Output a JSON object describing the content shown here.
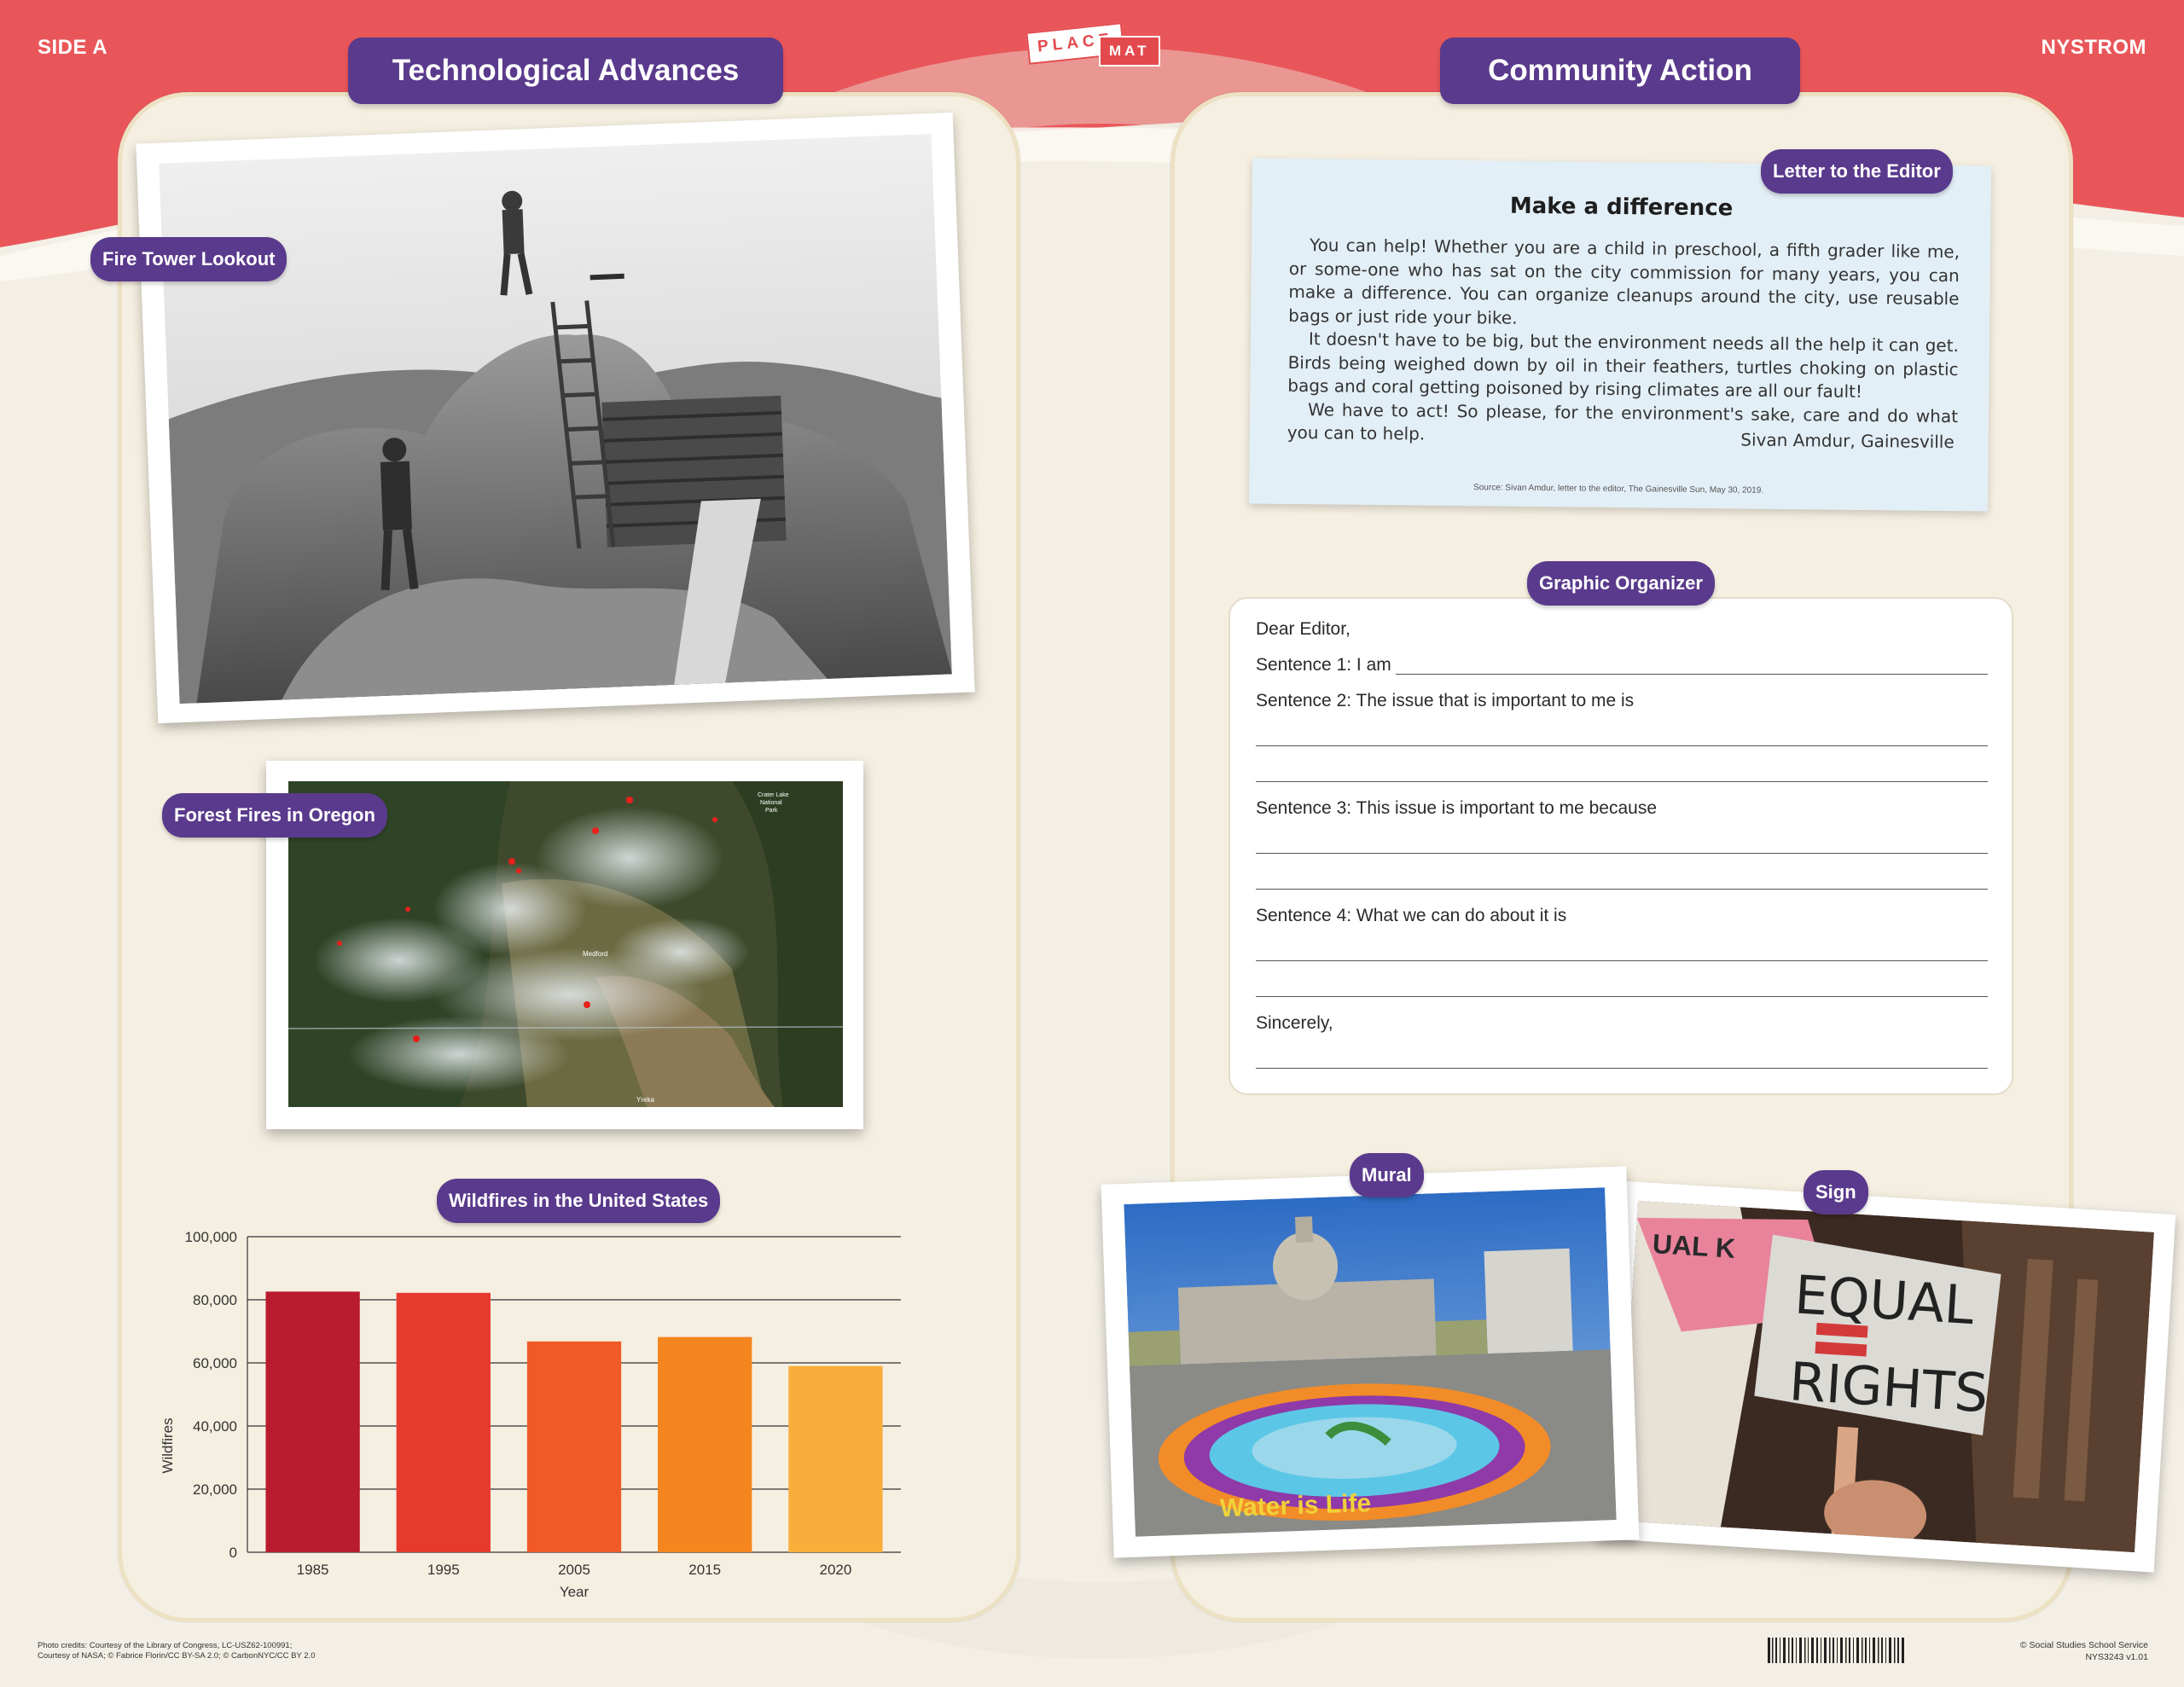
{
  "header": {
    "side_label": "SIDE A",
    "brand": "NYSTROM",
    "logo_top": "PLACE",
    "logo_bottom": "MAT"
  },
  "left_panel": {
    "title": "Technological Advances",
    "fire_tower_label": "Fire Tower Lookout",
    "forest_fires_label": "Forest Fires in Oregon",
    "map_labels": {
      "park": "Crater Lake National Park",
      "city": "Medford",
      "bottom": "Yreka"
    },
    "chart_label": "Wildfires in the United States"
  },
  "right_panel": {
    "title": "Community Action",
    "letter_label": "Letter to the Editor",
    "letter": {
      "title": "Make a difference",
      "paragraphs": [
        "You can help! Whether you are a child in preschool, a fifth grader like me, or some-one who has sat on the city commission for many years, you can make a difference. You can organize cleanups around the city, use reusable bags or just ride your bike.",
        "It doesn't have to be big, but the environment needs all the help it can get. Birds being weighed down by oil in their feathers, turtles choking on plastic bags and coral getting poisoned by rising climates are all our fault!",
        "We have to act! So please, for the environment's sake, care and do what you can to help."
      ],
      "signature": "Sivan Amdur, Gainesville",
      "source": "Source: Sivan Amdur, letter to the editor, The Gainesville Sun, May 30, 2019."
    },
    "organizer_label": "Graphic Organizer",
    "organizer": {
      "greeting": "Dear Editor,",
      "s1": "Sentence 1: I am",
      "s2": "Sentence 2: The issue that is important to me is",
      "s3": "Sentence 3: This issue is important to me because",
      "s4": "Sentence 4: What we can do about it is",
      "closing": "Sincerely,"
    },
    "mural_label": "Mural",
    "mural_text": "Water is Life",
    "sign_label": "Sign",
    "sign_text_1": "EQUAL",
    "sign_text_2": "RIGHTS",
    "banner_text": "UAL K"
  },
  "chart_data": {
    "type": "bar",
    "title": "",
    "xlabel": "Year",
    "ylabel": "Wildfires",
    "categories": [
      "1985",
      "1995",
      "2005",
      "2015",
      "2020"
    ],
    "values": [
      82600,
      82200,
      66800,
      68200,
      59000
    ],
    "colors": [
      "#b91c2e",
      "#e63a2e",
      "#f05a28",
      "#f5851f",
      "#f9ad3b"
    ],
    "ylim": [
      0,
      100000
    ],
    "yticks": [
      "0",
      "20,000",
      "40,000",
      "60,000",
      "80,000",
      "100,000"
    ],
    "grid": true
  },
  "footer": {
    "credits_1": "Photo credits: Courtesy of the Library of Congress, LC-USZ62-100991;",
    "credits_2": "Courtesy of NASA; © Fabrice Florin/CC BY-SA 2.0; © CarbonNYC/CC BY 2.0",
    "copyright": "© Social Studies School Service",
    "code": "NYS3243   v1.01"
  },
  "colors": {
    "header_red": "#e9565a",
    "accent_purple": "#5a3a8c",
    "panel": "#f5efe1"
  }
}
